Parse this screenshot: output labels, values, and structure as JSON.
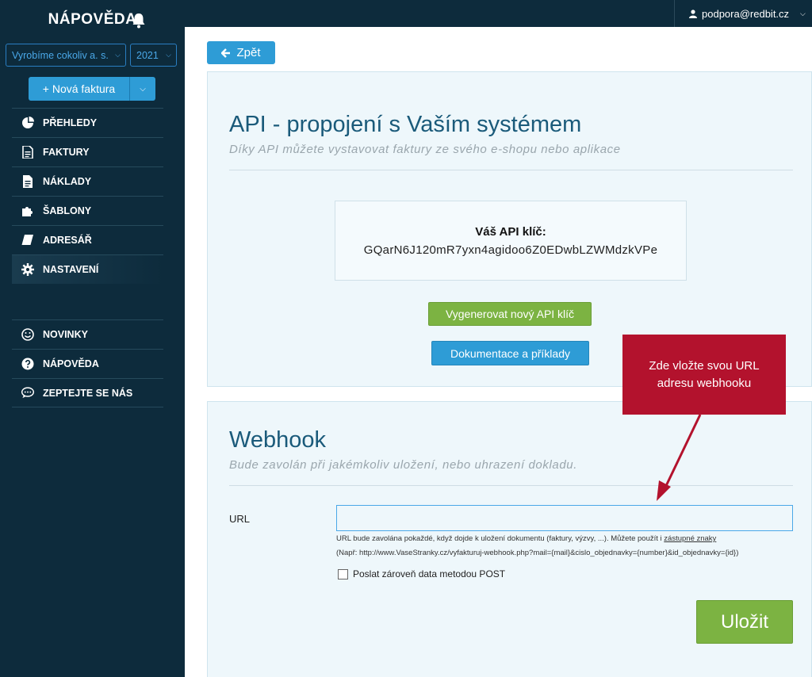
{
  "sidebar": {
    "brand": "NÁPOVĚDA",
    "company_select": "Vyrobíme cokoliv a. s.",
    "year_select": "2021",
    "new_invoice": "+ Nová faktura",
    "nav_main": [
      {
        "label": "PŘEHLEDY",
        "icon": "pie-chart-icon"
      },
      {
        "label": "FAKTURY",
        "icon": "invoice-icon"
      },
      {
        "label": "NÁKLADY",
        "icon": "expense-doc-icon"
      },
      {
        "label": "ŠABLONY",
        "icon": "puzzle-icon"
      },
      {
        "label": "ADRESÁŘ",
        "icon": "book-icon"
      },
      {
        "label": "NASTAVENÍ",
        "icon": "gear-icon",
        "active": true
      }
    ],
    "nav_secondary": [
      {
        "label": "NOVINKY",
        "icon": "smiley-icon"
      },
      {
        "label": "NÁPOVĚDA",
        "icon": "help-icon"
      },
      {
        "label": "ZEPTEJTE SE NÁS",
        "icon": "chat-icon"
      }
    ]
  },
  "header": {
    "user_email": "podpora@redbit.cz"
  },
  "main": {
    "back_label": "Zpět",
    "api": {
      "title": "API - propojení s Vaším systémem",
      "subtitle": "Díky API můžete vystavovat faktury ze svého e-shopu nebo aplikace",
      "key_label": "Váš API klíč:",
      "key_value": "GQarN6J120mR7yxn4agidoo6Z0EDwbLZWMdzkVPe",
      "generate_button": "Vygenerovat nový API klíč",
      "docs_button": "Dokumentace a příklady"
    },
    "webhook": {
      "title": "Webhook",
      "subtitle": "Bude zavolán při jakémkoliv uložení, nebo uhrazení dokladu.",
      "url_label": "URL",
      "url_value": "",
      "hint_text": "URL bude zavolána pokaždé, když dojde k uložení dokumentu (faktury, výzvy, ...). Můžete použít i ",
      "hint_link": "zástupné znaky",
      "example_text": "(Např: http://www.VaseStranky.cz/vyfakturuj-webhook.php?mail={mail}&cislo_objednavky={number}&id_objednavky={id})",
      "post_checkbox_label": "Poslat zároveň data metodou POST",
      "post_checked": false,
      "save_button": "Uložit"
    },
    "callout": "Zde vložte svou URL adresu webhooku"
  },
  "colors": {
    "sidebar_bg": "#0d2b3c",
    "primary_blue": "#2e9cd6",
    "green": "#7cb342",
    "callout_red": "#b3122d",
    "title_blue": "#1a5a7a"
  }
}
